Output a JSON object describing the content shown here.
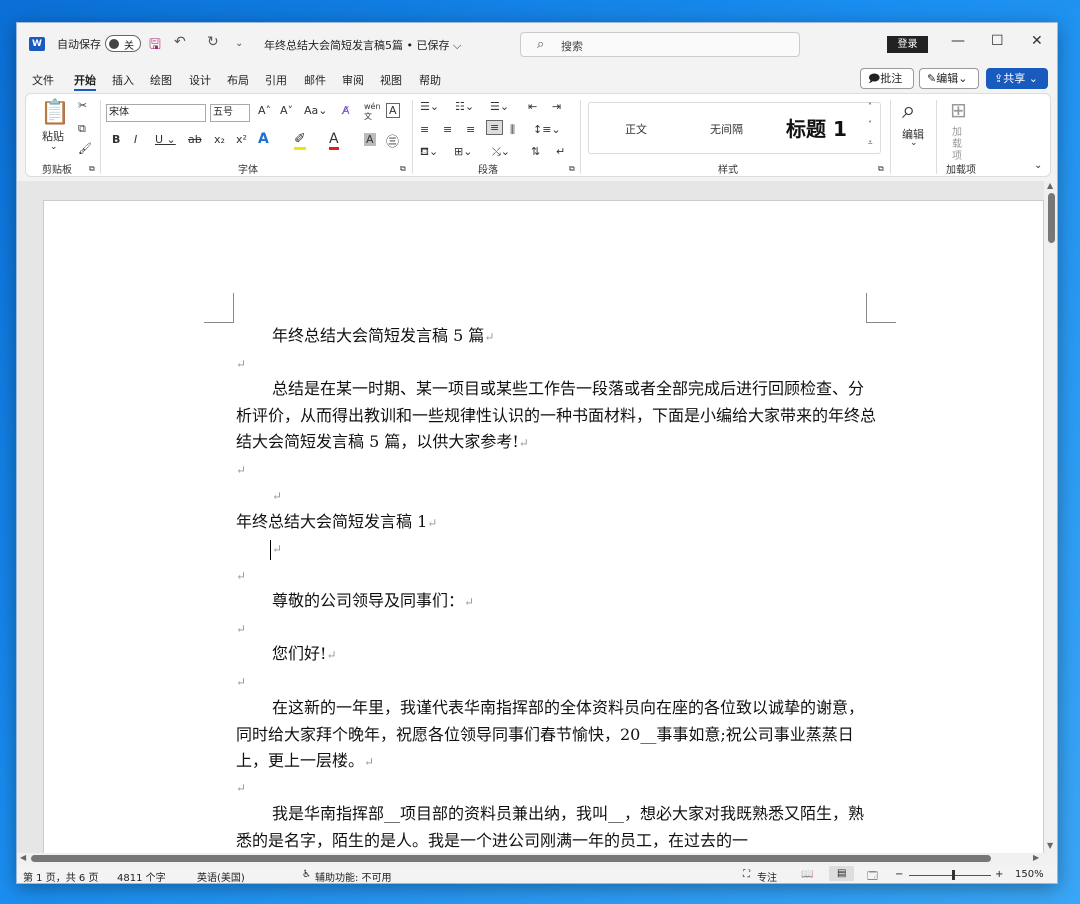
{
  "titlebar": {
    "app_icon": "word-logo",
    "autosave_label": "自动保存",
    "autosave_state": "关",
    "doc_title": "年终总结大会简短发言稿5篇 • 已保存 ⌵",
    "search_placeholder": "搜索",
    "login_label": "登录"
  },
  "tabs": [
    "文件",
    "开始",
    "插入",
    "绘图",
    "设计",
    "布局",
    "引用",
    "邮件",
    "审阅",
    "视图",
    "帮助"
  ],
  "ribbon_right": {
    "comment_label": "批注",
    "edit_label": "编辑",
    "share_label": "共享"
  },
  "ribbon": {
    "paste_label": "粘贴",
    "font_name": "宋体",
    "font_size": "五号",
    "style_normal": "正文",
    "style_nospacing": "无间隔",
    "style_heading1": "标题 1",
    "find_label": "编辑",
    "addin_label": "加载项",
    "addin_btn": "加载项",
    "groups": [
      "剪贴板",
      "字体",
      "段落",
      "样式",
      "加载项"
    ]
  },
  "document": {
    "paragraphs": [
      "年终总结大会简短发言稿 5 篇",
      "",
      "总结是在某一时期、某一项目或某些工作告一段落或者全部完成后进行回顾检查、分析评价，从而得出教训和一些规律性认识的一种书面材料，下面是小编给大家带来的年终总结大会简短发言稿 5 篇，以供大家参考!",
      "",
      "",
      "年终总结大会简短发言稿 1",
      "",
      "",
      "尊敬的公司领导及同事们：",
      "",
      "您们好!",
      "",
      "在这新的一年里，我谨代表华南指挥部的全体资料员向在座的各位致以诚挚的谢意，同时给大家拜个晚年，祝愿各位领导同事们春节愉快，20__事事如意;祝公司事业蒸蒸日上，更上一层楼。",
      "",
      "我是华南指挥部__项目部的资料员兼出纳，我叫__，想必大家对我既熟悉又陌生，熟悉的是名字，陌生的是人。我是一个进公司刚满一年的员工，在过去的一"
    ]
  },
  "status": {
    "page_info": "第 1 页，共 6 页",
    "word_count": "4811 个字",
    "language": "英语(美国)",
    "accessibility": "辅助功能: 不可用",
    "focus_label": "专注",
    "zoom": "150%"
  }
}
